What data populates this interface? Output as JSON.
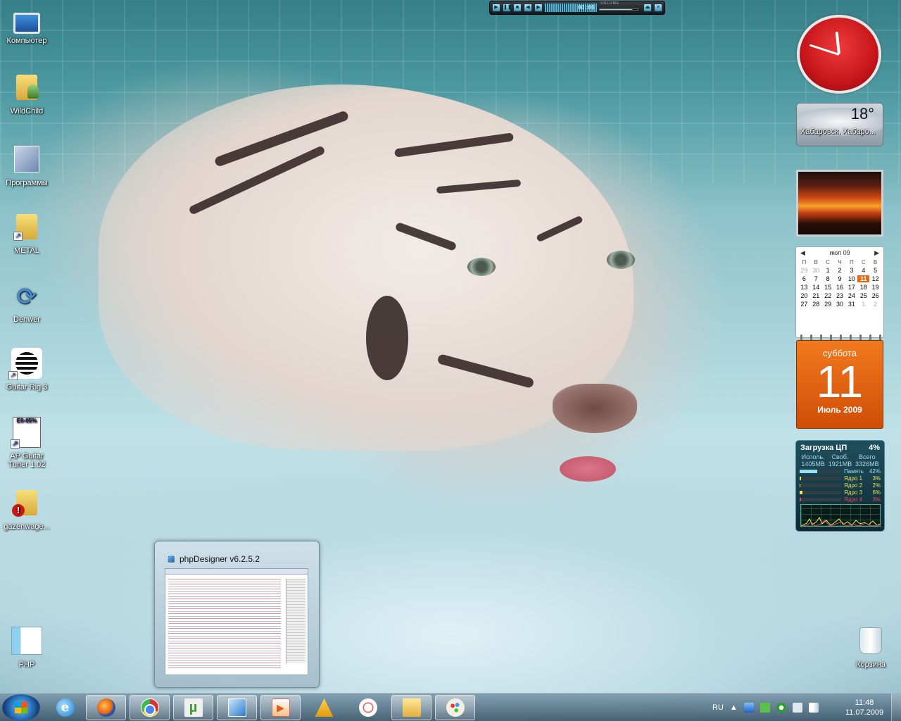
{
  "desktop": {
    "icons": [
      {
        "label": "Компьютер",
        "icon": "computer-icon"
      },
      {
        "label": "WildChild",
        "icon": "user-folder-icon"
      },
      {
        "label": "Программы",
        "icon": "programs-icon"
      },
      {
        "label": "METAL",
        "icon": "music-folder-icon"
      },
      {
        "label": "Denwer",
        "icon": "denwer-icon"
      },
      {
        "label": "Guitar Rig 3",
        "icon": "guitar-rig-icon"
      },
      {
        "label": "AP Guitar Tuner 1.02",
        "icon": "tuner-icon"
      },
      {
        "label": "gazenwage...",
        "icon": "folder-warning-icon"
      },
      {
        "label": "PHP",
        "icon": "php-icon"
      },
      {
        "label": "Корзина",
        "icon": "recycle-bin-icon"
      }
    ],
    "tuner_display": "E0-05%"
  },
  "media_player": {
    "time": "00:00",
    "volume_label": "VOLUME",
    "volume_level": 0.85
  },
  "gadgets": {
    "clock": {
      "hour": 11,
      "minute": 48
    },
    "weather": {
      "temperature": "18°",
      "city": "Хабаровск, Хабаро..."
    },
    "calendar": {
      "month_label": "июл 09",
      "weekdays": [
        "П",
        "В",
        "С",
        "Ч",
        "П",
        "С",
        "В"
      ],
      "weeks": [
        [
          "29",
          "30",
          "1",
          "2",
          "3",
          "4",
          "5"
        ],
        [
          "6",
          "7",
          "8",
          "9",
          "10",
          "11",
          "12"
        ],
        [
          "13",
          "14",
          "15",
          "16",
          "17",
          "18",
          "19"
        ],
        [
          "20",
          "21",
          "22",
          "23",
          "24",
          "25",
          "26"
        ],
        [
          "27",
          "28",
          "29",
          "30",
          "31",
          "1",
          "2"
        ]
      ],
      "today": "11",
      "day_page": {
        "weekday": "суббота",
        "day": "11",
        "month_year": "Июль 2009"
      }
    },
    "cpu": {
      "title": "Загрузка ЦП",
      "total": "4%",
      "mem_headers": [
        "Исполь.",
        "Своб.",
        "Всего"
      ],
      "mem_values": [
        "1405MB",
        "1921MB",
        "3326MB"
      ],
      "rows": [
        {
          "label": "Память",
          "pct": "42%",
          "level": 42,
          "color": "#9ce1f0"
        },
        {
          "label": "Ядро 1",
          "pct": "3%",
          "level": 3,
          "color": "#f0e05a"
        },
        {
          "label": "Ядро 2",
          "pct": "2%",
          "level": 2,
          "color": "#f0e05a"
        },
        {
          "label": "Ядро 3",
          "pct": "6%",
          "level": 6,
          "color": "#f0e05a"
        },
        {
          "label": "Ядро 4",
          "pct": "3%",
          "level": 3,
          "color": "#e04a6a"
        }
      ]
    }
  },
  "preview": {
    "title": "phpDesigner v6.2.5.2"
  },
  "taskbar": {
    "apps": [
      {
        "name": "internet-explorer",
        "icon": "ie-icon"
      },
      {
        "name": "firefox",
        "icon": "firefox-icon"
      },
      {
        "name": "chrome",
        "icon": "chrome-icon"
      },
      {
        "name": "utorrent",
        "icon": "utorrent-icon"
      },
      {
        "name": "phpdesigner",
        "icon": "phpdesigner-icon"
      },
      {
        "name": "media-player",
        "icon": "media-icon"
      },
      {
        "name": "aimp",
        "icon": "aimp-icon"
      },
      {
        "name": "snipping-tool",
        "icon": "snip-icon"
      },
      {
        "name": "explorer",
        "icon": "explorer-icon"
      },
      {
        "name": "paint",
        "icon": "paint-icon"
      }
    ],
    "language": "RU",
    "time": "11:48",
    "date": "11.07.2009"
  }
}
